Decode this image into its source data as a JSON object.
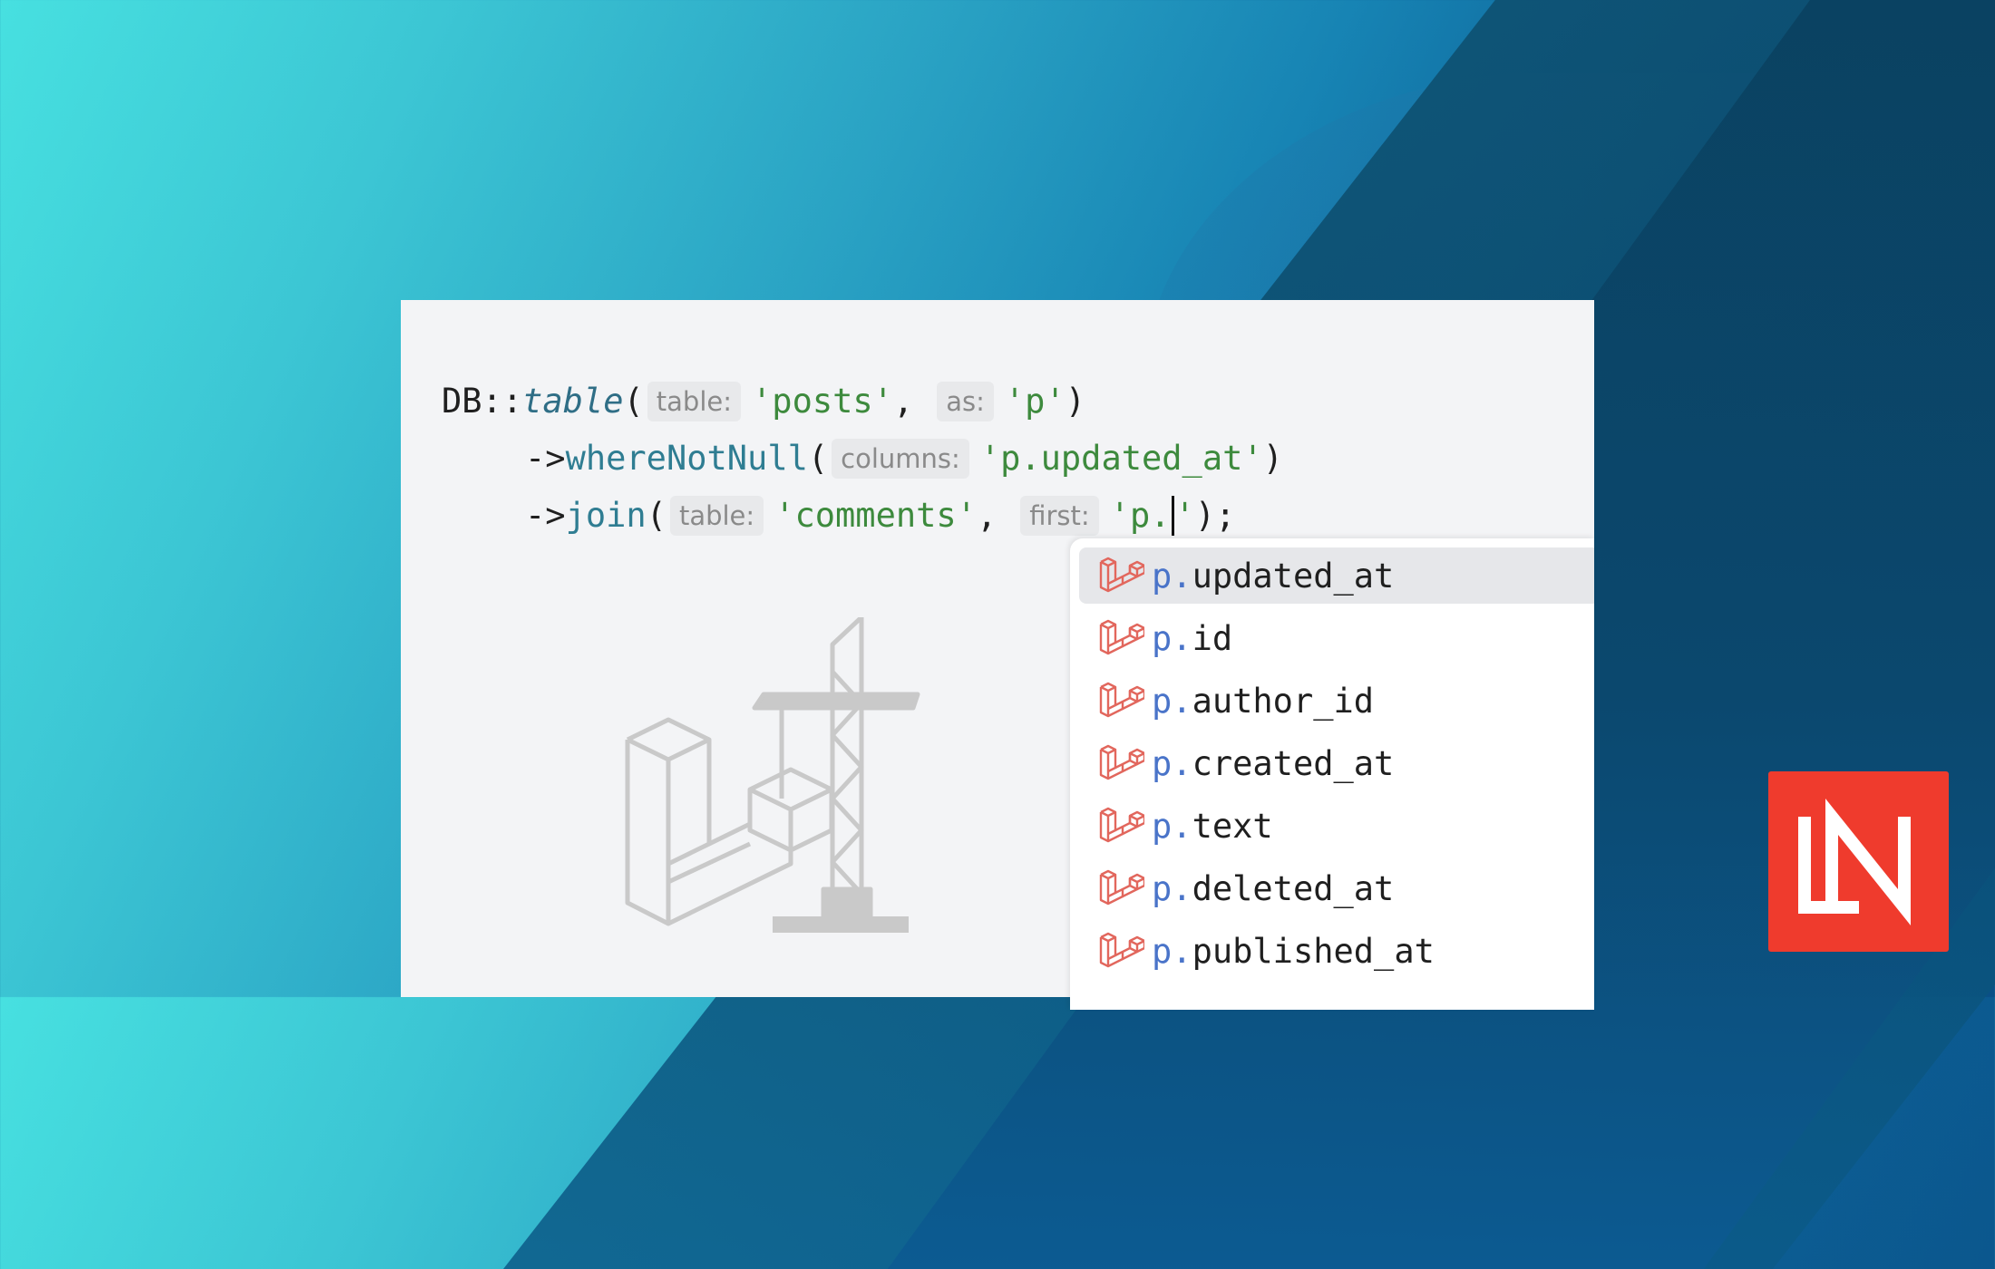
{
  "code": {
    "line1": {
      "prefix": "DB::",
      "method": "table",
      "open": "(",
      "hint1": "table:",
      "arg1": "'posts'",
      "comma": ",",
      "hint2": "as:",
      "arg2": "'p'",
      "close": ")"
    },
    "line2": {
      "arrow": "->",
      "method": "whereNotNull",
      "open": "(",
      "hint1": "columns:",
      "arg1": "'p.updated_at'",
      "close": ")"
    },
    "line3": {
      "arrow": "->",
      "method": "join",
      "open": "(",
      "hint1": "table:",
      "arg1": "'comments'",
      "comma": ",",
      "hint2": "first:",
      "arg2_before": "'p.",
      "arg2_after": "'",
      "close": ");"
    }
  },
  "autocomplete": {
    "icon": "laravel-icon",
    "items": [
      {
        "prefix": "p.",
        "name": "updated_at",
        "selected": true
      },
      {
        "prefix": "p.",
        "name": "id"
      },
      {
        "prefix": "p.",
        "name": "author_id"
      },
      {
        "prefix": "p.",
        "name": "created_at"
      },
      {
        "prefix": "p.",
        "name": "text"
      },
      {
        "prefix": "p.",
        "name": "deleted_at"
      },
      {
        "prefix": "p.",
        "name": "published_at"
      }
    ]
  },
  "branding": {
    "logo": "LN"
  },
  "colors": {
    "logo_bg": "#ef3b2d",
    "string": "#3d8a3d",
    "method": "#2f7d92",
    "prefix": "#4a74c9"
  }
}
